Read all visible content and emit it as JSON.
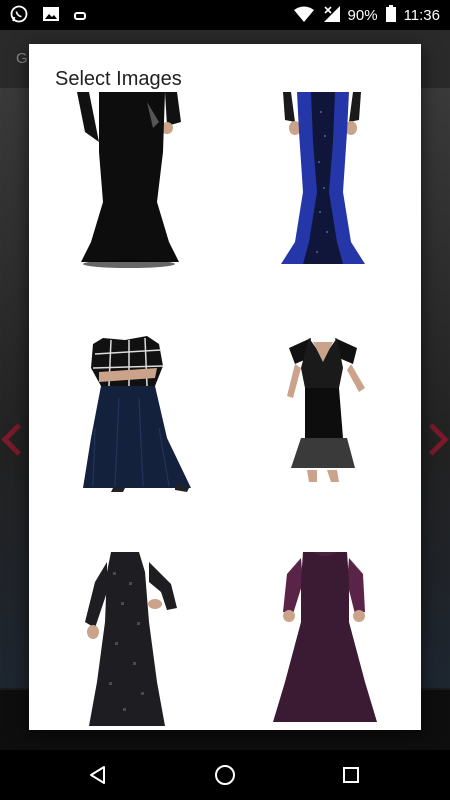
{
  "status_bar": {
    "icons_left": [
      "whatsapp-icon",
      "image-icon",
      "notification-icon"
    ],
    "icons_right": [
      "wifi-icon",
      "signal-icon",
      "battery-icon"
    ],
    "battery": "90%",
    "time": "11:36"
  },
  "background": {
    "app_title_partial": "G"
  },
  "dialog": {
    "title": "Select Images",
    "images": [
      {
        "name": "black-long-sleeve-gown",
        "colors": [
          "#0d0d0d"
        ]
      },
      {
        "name": "blue-sequin-gown",
        "colors": [
          "#2537a8",
          "#10163a"
        ]
      },
      {
        "name": "plaid-top-navy-tulle-gown",
        "colors": [
          "#14213d",
          "#1a1a1a"
        ]
      },
      {
        "name": "black-v-neck-gown",
        "colors": [
          "#111111",
          "#3a3a3a"
        ]
      },
      {
        "name": "black-tweed-long-dress",
        "colors": [
          "#1e1e22",
          "#5a5a5a"
        ]
      },
      {
        "name": "plum-lace-sleeve-gown",
        "colors": [
          "#3b1a33",
          "#5a2448"
        ]
      }
    ]
  },
  "nav_bar": {
    "icons": [
      "back-icon",
      "home-icon",
      "recents-icon"
    ]
  }
}
